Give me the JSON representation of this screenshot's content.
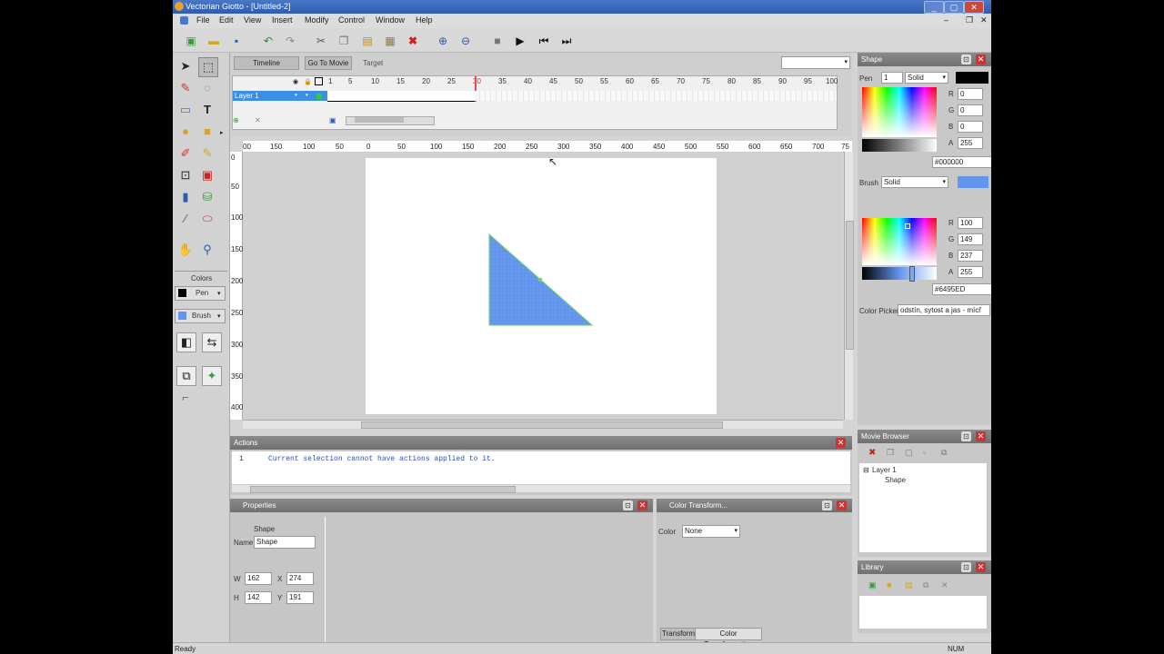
{
  "window": {
    "title": "Vectorian Giotto - [Untitled-2]",
    "min": "_",
    "max": "▢",
    "close": "✕"
  },
  "menu": [
    "File",
    "Edit",
    "View",
    "Insert",
    "Modify",
    "Control",
    "Window",
    "Help"
  ],
  "toolbar": {
    "icons": [
      "new-icon",
      "open-icon",
      "save-icon",
      "undo-icon",
      "redo-icon",
      "cut-icon",
      "copy-icon",
      "paste-icon",
      "paste-special-icon",
      "delete-icon",
      "zoom-in-icon",
      "zoom-out-icon",
      "stop-icon",
      "play-icon",
      "rewind-icon",
      "forward-end-icon"
    ]
  },
  "timeline": {
    "tab": "Timeline",
    "goto_movie": "Go To Movie",
    "target": "Target",
    "frames": [
      "1",
      "5",
      "10",
      "15",
      "20",
      "25",
      "30",
      "35",
      "40",
      "45",
      "50",
      "55",
      "60",
      "65",
      "70",
      "75",
      "80",
      "85",
      "90",
      "95",
      "100"
    ],
    "layer": "Layer 1",
    "current_frame": "30"
  },
  "ruler": {
    "h": [
      "00",
      "150",
      "100",
      "50",
      "0",
      "50",
      "100",
      "150",
      "200",
      "250",
      "300",
      "350",
      "400",
      "450",
      "500",
      "550",
      "600",
      "650",
      "700",
      "75"
    ],
    "v": [
      "0",
      "50",
      "100",
      "150",
      "200",
      "250",
      "300",
      "350",
      "400"
    ]
  },
  "colors_section": {
    "title": "Colors",
    "pen": "Pen",
    "brush": "Brush"
  },
  "shape_panel": {
    "title": "Shape",
    "pen_label": "Pen",
    "pen_width": "1",
    "pen_style": "Solid",
    "pen_rgba": {
      "r": "0",
      "g": "0",
      "b": "0",
      "a": "255"
    },
    "pen_hex": "#000000",
    "brush_label": "Brush",
    "brush_style": "Solid",
    "brush_rgba": {
      "r": "100",
      "g": "149",
      "b": "237",
      "a": "255"
    },
    "brush_hex": "#6495ED",
    "r": "R",
    "g": "G",
    "b": "B",
    "a": "A",
    "picker_label": "Color Picker",
    "picker_value": "odstín, sytost a jas - mícř"
  },
  "movie_browser": {
    "title": "Movie Browser",
    "tree": [
      "Layer 1",
      "Shape"
    ]
  },
  "library": {
    "title": "Library"
  },
  "actions": {
    "title": "Actions",
    "line_no": "1",
    "text": "Current selection cannot have actions applied to it."
  },
  "properties": {
    "title": "Properties",
    "type": "Shape",
    "name_label": "Name",
    "name_value": "Shape",
    "w_label": "W",
    "w": "162",
    "h_label": "H",
    "h": "142",
    "x_label": "X",
    "x": "274",
    "y_label": "Y",
    "y": "191"
  },
  "color_transform": {
    "title": "Color Transform...",
    "color_label": "Color",
    "color_value": "None",
    "tabs": [
      "Transform",
      "Color Transformation"
    ]
  },
  "status": {
    "left": "Ready",
    "right": "NUM"
  },
  "colors": {
    "shape_fill": "#6495ED",
    "title_bar": "#2d5bb0"
  }
}
